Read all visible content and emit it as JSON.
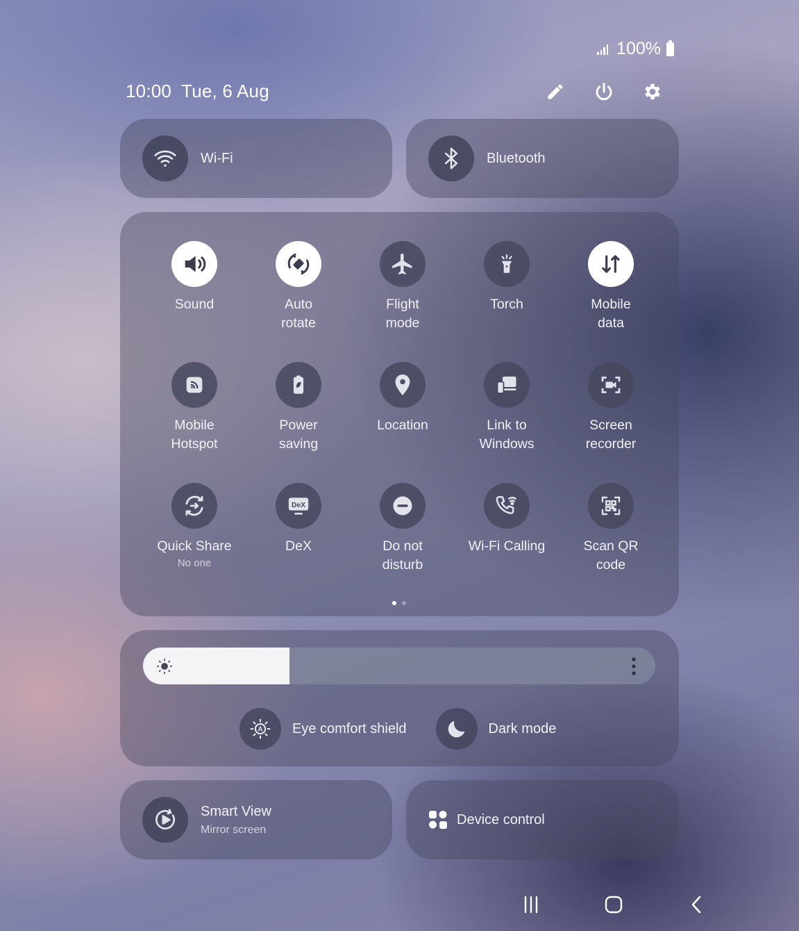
{
  "status_bar": {
    "battery": "100%"
  },
  "header": {
    "time": "10:00",
    "date": "Tue, 6 Aug"
  },
  "header_actions": [
    "edit-icon",
    "power-icon",
    "settings-icon"
  ],
  "top_pills": [
    {
      "label": "Wi-Fi",
      "icon": "wifi-icon"
    },
    {
      "label": "Bluetooth",
      "icon": "bluetooth-icon"
    }
  ],
  "tiles": [
    {
      "label": "Sound",
      "sub": "",
      "icon": "sound-icon",
      "active": true
    },
    {
      "label": "Auto\nrotate",
      "sub": "",
      "icon": "auto-rotate-icon",
      "active": true
    },
    {
      "label": "Flight\nmode",
      "sub": "",
      "icon": "airplane-icon",
      "active": false
    },
    {
      "label": "Torch",
      "sub": "",
      "icon": "torch-icon",
      "active": false
    },
    {
      "label": "Mobile\ndata",
      "sub": "",
      "icon": "mobile-data-icon",
      "active": true
    },
    {
      "label": "Mobile\nHotspot",
      "sub": "",
      "icon": "hotspot-icon",
      "active": false
    },
    {
      "label": "Power\nsaving",
      "sub": "",
      "icon": "power-saving-icon",
      "active": false
    },
    {
      "label": "Location",
      "sub": "",
      "icon": "location-icon",
      "active": false
    },
    {
      "label": "Link to\nWindows",
      "sub": "",
      "icon": "link-to-windows-icon",
      "active": false
    },
    {
      "label": "Screen\nrecorder",
      "sub": "",
      "icon": "screen-recorder-icon",
      "active": false
    },
    {
      "label": "Quick Share",
      "sub": "No one",
      "icon": "quick-share-icon",
      "active": false
    },
    {
      "label": "DeX",
      "sub": "",
      "icon": "dex-icon",
      "active": false
    },
    {
      "label": "Do not\ndisturb",
      "sub": "",
      "icon": "do-not-disturb-icon",
      "active": false
    },
    {
      "label": "Wi-Fi Calling",
      "sub": "",
      "icon": "wifi-calling-icon",
      "active": false
    },
    {
      "label": "Scan QR\ncode",
      "sub": "",
      "icon": "qr-scan-icon",
      "active": false
    }
  ],
  "pager": {
    "pages": 2,
    "current": 1
  },
  "brightness": {
    "level": 0.286
  },
  "display_toggles": [
    {
      "label": "Eye comfort shield",
      "icon": "eye-comfort-icon"
    },
    {
      "label": "Dark mode",
      "icon": "moon-icon"
    }
  ],
  "bottom_pills": {
    "smart_view": {
      "label": "Smart View",
      "sub": "Mirror screen",
      "icon": "smart-view-icon"
    },
    "device_control": {
      "label": "Device control",
      "icon": "device-control-icon"
    }
  },
  "nav_bar": [
    "recents-icon",
    "home-icon",
    "back-icon"
  ],
  "colors": {
    "tile_on": "#ffffff",
    "tile_off": "#46485e",
    "tile_on_icon": "#3b3c4e"
  }
}
